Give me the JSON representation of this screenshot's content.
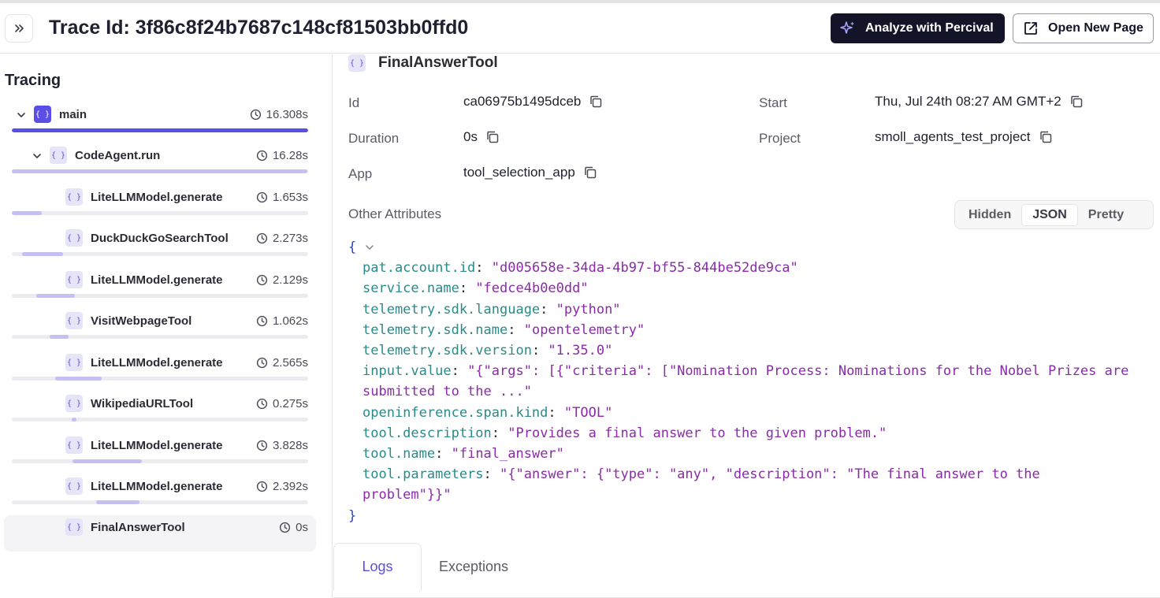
{
  "header": {
    "title": "Trace Id: 3f86c8f24b7687c148cf81503bb0ffd0",
    "analyze_label": "Analyze with Percival",
    "open_page_label": "Open New Page"
  },
  "tracing": {
    "title": "Tracing",
    "badge_text": "{ }",
    "spans": [
      {
        "name": "main",
        "duration": "16.308s",
        "fill": 1.0
      },
      {
        "name": "CodeAgent.run",
        "duration": "16.28s",
        "fill": 0.998
      },
      {
        "name": "LiteLLMModel.generate",
        "duration": "1.653s",
        "start": 0.0,
        "fill": 0.101
      },
      {
        "name": "DuckDuckGoSearchTool",
        "duration": "2.273s",
        "start": 0.035,
        "fill": 0.139
      },
      {
        "name": "LiteLLMModel.generate",
        "duration": "2.129s",
        "start": 0.082,
        "fill": 0.131
      },
      {
        "name": "VisitWebpageTool",
        "duration": "1.062s",
        "start": 0.127,
        "fill": 0.065
      },
      {
        "name": "LiteLLMModel.generate",
        "duration": "2.565s",
        "start": 0.147,
        "fill": 0.157
      },
      {
        "name": "WikipediaURLTool",
        "duration": "0.275s",
        "start": 0.201,
        "fill": 0.017
      },
      {
        "name": "LiteLLMModel.generate",
        "duration": "3.828s",
        "start": 0.204,
        "fill": 0.235
      },
      {
        "name": "LiteLLMModel.generate",
        "duration": "2.392s",
        "start": 0.285,
        "fill": 0.147
      },
      {
        "name": "FinalAnswerTool",
        "duration": "0s",
        "start": 0.0,
        "fill": 0.0
      }
    ]
  },
  "detail": {
    "title": "FinalAnswerTool",
    "id_label": "Id",
    "id_value": "ca06975b1495dceb",
    "duration_label": "Duration",
    "duration_value": "0s",
    "app_label": "App",
    "app_value": "tool_selection_app",
    "start_label": "Start",
    "start_value": "Thu, Jul 24th 08:27 AM GMT+2",
    "project_label": "Project",
    "project_value": "smoll_agents_test_project",
    "other_attributes_label": "Other Attributes",
    "view_options": [
      "Hidden",
      "JSON",
      "Pretty"
    ],
    "view_selected": "JSON",
    "json_open": "{",
    "json_close": "}",
    "attributes": [
      {
        "key": "pat.account.id",
        "value": "\"d005658e-34da-4b97-bf55-844be52de9ca\""
      },
      {
        "key": "service.name",
        "value": "\"fedce4b0e0dd\""
      },
      {
        "key": "telemetry.sdk.language",
        "value": "\"python\""
      },
      {
        "key": "telemetry.sdk.name",
        "value": "\"opentelemetry\""
      },
      {
        "key": "telemetry.sdk.version",
        "value": "\"1.35.0\""
      },
      {
        "key": "input.value",
        "value": "\"{\"args\": [{\"criteria\": [\"Nomination Process: Nominations for the Nobel Prizes are",
        "cont": "submitted to the ...\""
      },
      {
        "key": "openinference.span.kind",
        "value": "\"TOOL\""
      },
      {
        "key": "tool.description",
        "value": "\"Provides a final answer to the given problem.\""
      },
      {
        "key": "tool.name",
        "value": "\"final_answer\""
      },
      {
        "key": "tool.parameters",
        "value": "\"{\"answer\": {\"type\": \"any\", \"description\": \"The final answer to the",
        "cont": "problem\"}}\""
      }
    ]
  },
  "tabs": {
    "logs": "Logs",
    "exceptions": "Exceptions",
    "active": "Logs"
  }
}
